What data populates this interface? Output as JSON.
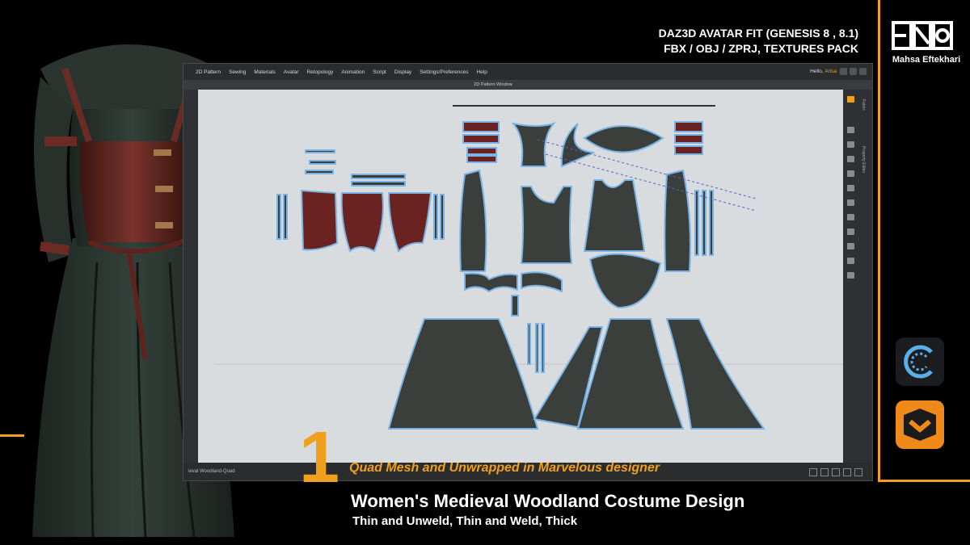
{
  "header": {
    "line1": "DAZ3D AVATAR FIT (GENESIS 8 , 8.1)",
    "line2": "FBX / OBJ / ZPRJ, TEXTURES PACK"
  },
  "brand": {
    "logo_icon": "eso-logo-icon",
    "name": "Mahsa Eftekhari"
  },
  "app": {
    "menu": [
      "2D Pattern",
      "Sewing",
      "Materials",
      "Avatar",
      "Retopology",
      "Animation",
      "Script",
      "Display",
      "Settings/Preferences",
      "Help"
    ],
    "greeting_prefix": "Hello, ",
    "greeting_user": "Arisa",
    "window_tab": "2D Pattern Window",
    "right_panel_labels": [
      "Fabric",
      "Property Editor"
    ],
    "footer_label": "ieval Woodland-Quad"
  },
  "overlay": {
    "number": "1",
    "tagline": "Quad Mesh and Unwrapped in Marvelous designer",
    "title": "Women's Medieval Woodland Costume Design",
    "subtitle": "Thin and Unweld, Thin and Weld, Thick"
  },
  "app_logos": [
    "clo3d-c-icon",
    "marvelous-designer-icon"
  ],
  "colors": {
    "accent": "#f0a01c",
    "pattern_fill": "#3a3f3b",
    "pattern_outline": "#7ab4e6",
    "leather": "#6a2320"
  }
}
